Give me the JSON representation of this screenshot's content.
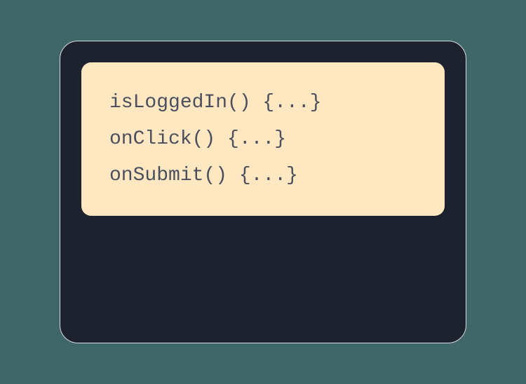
{
  "code": {
    "lines": [
      "isLoggedIn() {...}",
      "onClick() {...}",
      "onSubmit() {...}"
    ]
  }
}
